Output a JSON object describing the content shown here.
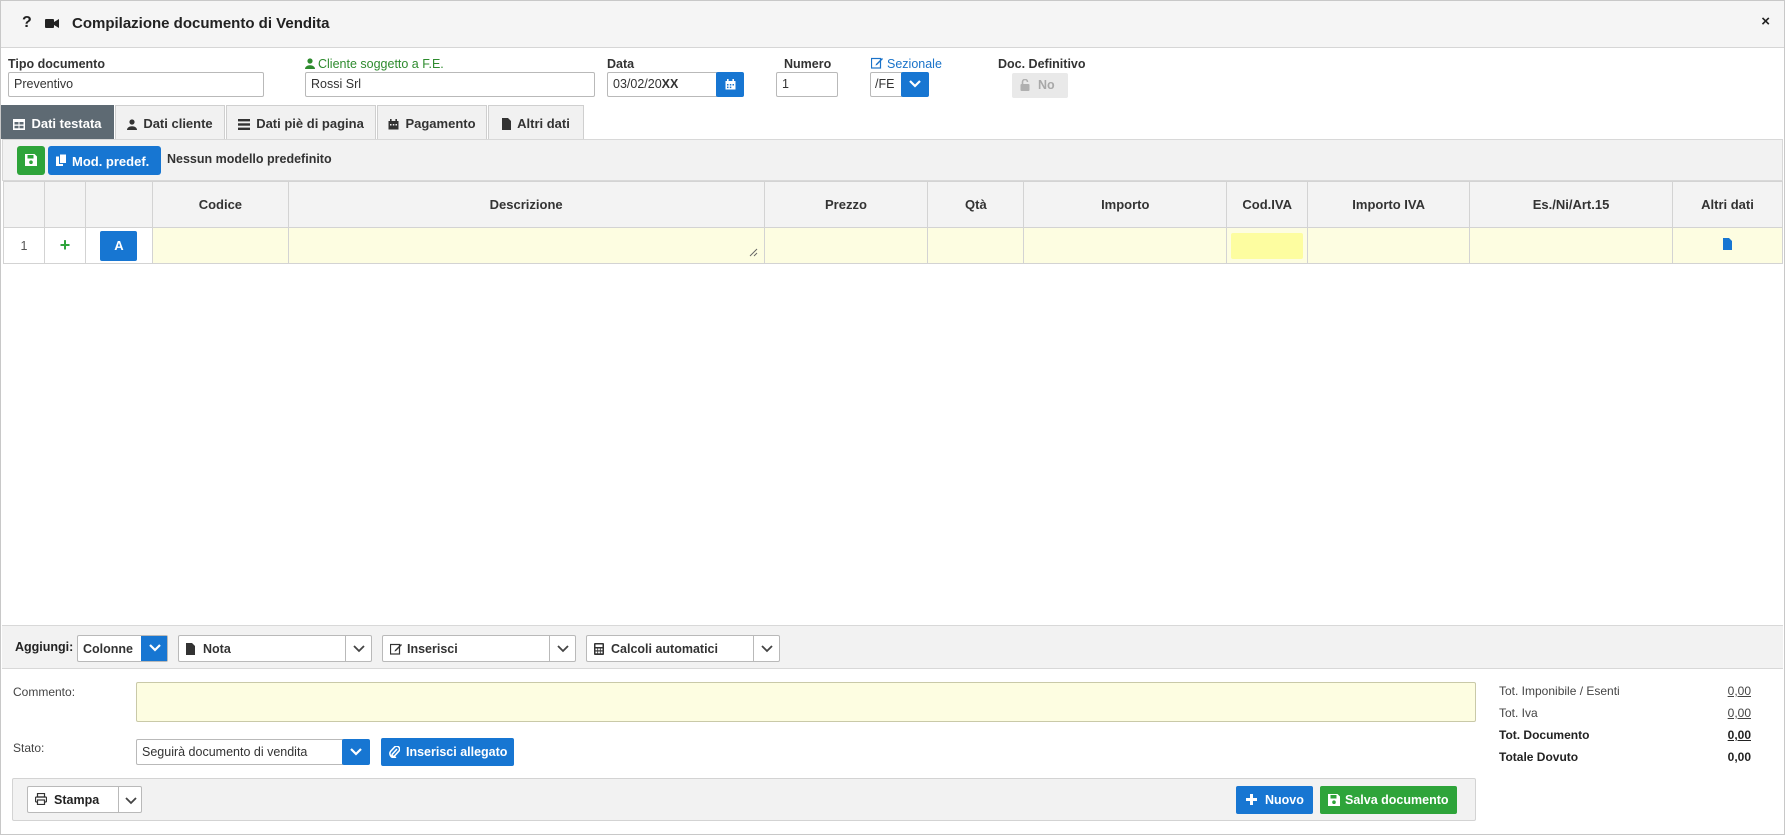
{
  "window": {
    "help_glyph": "?",
    "title": "Compilazione documento di Vendita",
    "close_glyph": "×"
  },
  "header": {
    "tipo_documento": {
      "label": "Tipo documento",
      "value": "Preventivo"
    },
    "cliente": {
      "label": "Cliente soggetto a F.E.",
      "value": "Rossi Srl"
    },
    "data": {
      "label": "Data",
      "value": "03/02/20",
      "suffix": "XX"
    },
    "numero": {
      "label": "Numero",
      "value": "1"
    },
    "sezionale": {
      "label": "Sezionale",
      "value": "/FE"
    },
    "doc_definitivo": {
      "label": "Doc. Definitivo",
      "value": "No"
    }
  },
  "tabs": [
    {
      "label": "Dati testata",
      "active": true,
      "icon": "table-icon"
    },
    {
      "label": "Dati cliente",
      "active": false,
      "icon": "user-icon"
    },
    {
      "label": "Dati piè di pagina",
      "active": false,
      "icon": "list-icon"
    },
    {
      "label": "Pagamento",
      "active": false,
      "icon": "calendar-icon"
    },
    {
      "label": "Altri dati",
      "active": false,
      "icon": "file-icon"
    }
  ],
  "toolbar": {
    "mod_predef_label": "Mod. predef.",
    "model_note": "Nessun modello predefinito"
  },
  "grid": {
    "columns": [
      "",
      "",
      "",
      "Codice",
      "Descrizione",
      "Prezzo",
      "Qtà",
      "Importo",
      "Cod.IVA",
      "Importo IVA",
      "Es./Ni/Art.15",
      "Altri dati"
    ],
    "rows": [
      {
        "num": "1",
        "add_glyph": "+",
        "type_button": "A",
        "codice": "",
        "descrizione": "",
        "prezzo": "",
        "qta": "",
        "importo": "",
        "cod_iva": "",
        "importo_iva": "",
        "es_ni": ""
      }
    ]
  },
  "addbar": {
    "label": "Aggiungi:",
    "colonne": "Colonne",
    "nota": "Nota",
    "inserisci": "Inserisci",
    "calcoli": "Calcoli automatici"
  },
  "lower": {
    "commento_label": "Commento:",
    "stato_label": "Stato:",
    "stato_value": "Seguirà documento di vendita",
    "inserisci_allegato": "Inserisci allegato"
  },
  "totals": {
    "imponibile_label": "Tot. Imponibile / Esenti",
    "imponibile_value": "0,00",
    "iva_label": "Tot. Iva",
    "iva_value": "0,00",
    "documento_label": "Tot. Documento",
    "documento_value": "0,00",
    "dovuto_label": "Totale Dovuto",
    "dovuto_value": "0,00"
  },
  "actions": {
    "stampa": "Stampa",
    "nuovo": "Nuovo",
    "salva": "Salva documento"
  },
  "colors": {
    "primary_blue": "#1776d2",
    "success_green": "#2ea43a",
    "active_tab": "#5e6a73",
    "input_yellow": "#fdfde1",
    "cod_iva_yellow": "#fdfda0"
  }
}
